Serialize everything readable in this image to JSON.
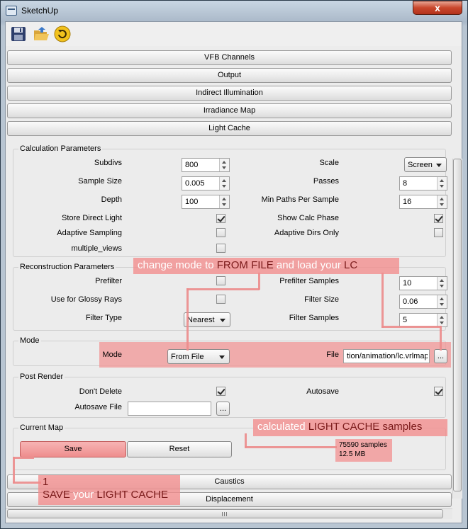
{
  "window": {
    "title": "SketchUp",
    "close": "x"
  },
  "toolbar": {
    "icons": [
      "save-icon",
      "open-folder-icon",
      "reload-icon"
    ]
  },
  "sections": {
    "vfb": "VFB Channels",
    "output": "Output",
    "indirect": "Indirect Illumination",
    "irradiance": "Irradiance Map",
    "light_cache": "Light Cache",
    "caustics": "Caustics",
    "displacement": "Displacement"
  },
  "calc": {
    "title": "Calculation Parameters",
    "subdivs_label": "Subdivs",
    "subdivs": "800",
    "sample_size_label": "Sample Size",
    "sample_size": "0.005",
    "depth_label": "Depth",
    "depth": "100",
    "store_direct_label": "Store Direct Light",
    "adaptive_sampling_label": "Adaptive Sampling",
    "multiple_views_label": "multiple_views",
    "scale_label": "Scale",
    "scale": "Screen",
    "passes_label": "Passes",
    "passes": "8",
    "min_paths_label": "Min Paths Per Sample",
    "min_paths": "16",
    "show_calc_label": "Show Calc Phase",
    "adaptive_dirs_label": "Adaptive Dirs Only"
  },
  "recon": {
    "title": "Reconstruction Parameters",
    "prefilter_label": "Prefilter",
    "glossy_label": "Use for Glossy Rays",
    "filter_type_label": "Filter Type",
    "filter_type": "Nearest",
    "prefilter_samples_label": "Prefilter Samples",
    "prefilter_samples": "10",
    "filter_size_label": "Filter Size",
    "filter_size": "0.06",
    "filter_samples_label": "Filter Samples",
    "filter_samples": "5"
  },
  "mode": {
    "title": "Mode",
    "mode_label": "Mode",
    "mode": "From File",
    "file_label": "File",
    "file": "tion/animation/lc.vrlmap",
    "browse": "..."
  },
  "post": {
    "title": "Post Render",
    "dont_delete_label": "Don't Delete",
    "autosave_label": "Autosave",
    "autosave_file_label": "Autosave File",
    "autosave_file": "",
    "browse": "..."
  },
  "current_map": {
    "title": "Current Map",
    "save": "Save",
    "reset": "Reset",
    "samples": "75590 samples",
    "size": "12.5 MB"
  },
  "annotations": {
    "mode_note": {
      "a": "change mode to ",
      "b": "FROM FILE",
      "c": " and load your ",
      "d": "LC"
    },
    "samples_note": {
      "a": "calculated ",
      "b": "LIGHT CACHE samples"
    },
    "save_note": {
      "num": "1",
      "a": "SAVE",
      "b": " your ",
      "c": "LIGHT CACHE"
    }
  },
  "colors": {
    "annotation_bg": "#f28c8c",
    "close_button": "#c9472c"
  }
}
